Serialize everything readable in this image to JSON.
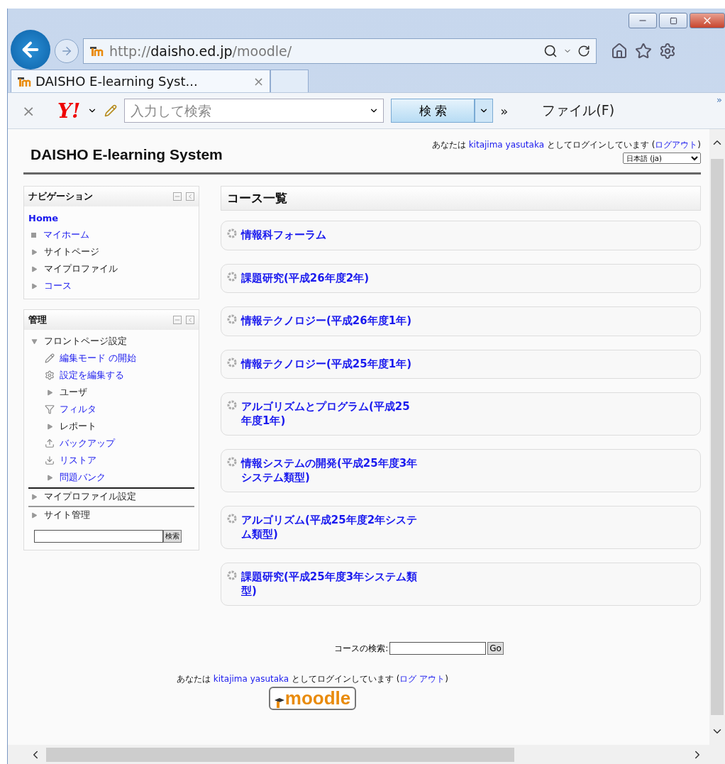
{
  "browser": {
    "address": {
      "scheme": "http://",
      "host": "daisho.ed.jp",
      "path": "/moodle/"
    },
    "tabs": [
      {
        "label": "DAISHO E-learning Syst...",
        "close": "×",
        "selected": true
      }
    ],
    "toolbar": {
      "close": "×",
      "brand": "Y!",
      "search_placeholder": "入力して検索",
      "search_button": "検 索",
      "more": "»",
      "menu": "ファイル(F)",
      "overflow": "»"
    }
  },
  "page": {
    "site_title": "DAISHO E-learning System",
    "login": {
      "before": "あなたは ",
      "user": "kitajima yasutaka",
      "after": " としてログインしています (",
      "logout": "ログアウト",
      "closing": ")"
    },
    "language": "日本語 (ja)",
    "navigation": {
      "title": "ナビゲーション",
      "items": [
        {
          "label": "Home",
          "kind": "home",
          "link": true,
          "children": [
            {
              "label": "マイホーム",
              "kind": "leaf",
              "link": true
            },
            {
              "label": "サイトページ",
              "kind": "branch",
              "expanded": false,
              "link": false
            },
            {
              "label": "マイプロファイル",
              "kind": "branch",
              "expanded": false,
              "link": false
            },
            {
              "label": "コース",
              "kind": "branch",
              "expanded": false,
              "link": true
            }
          ]
        }
      ]
    },
    "administration": {
      "title": "管理",
      "search_button": "検索",
      "items": [
        {
          "label": "フロントページ設定",
          "kind": "branch",
          "expanded": true,
          "link": false,
          "children": [
            {
              "label": "編集モード の開始",
              "kind": "pencil",
              "link": true
            },
            {
              "label": "設定を編集する",
              "kind": "gear",
              "link": true
            },
            {
              "label": "ユーザ",
              "kind": "branch",
              "expanded": false,
              "link": false
            },
            {
              "label": "フィルタ",
              "kind": "filter",
              "link": true
            },
            {
              "label": "レポート",
              "kind": "branch",
              "expanded": false,
              "link": false
            },
            {
              "label": "バックアップ",
              "kind": "backup",
              "link": true
            },
            {
              "label": "リストア",
              "kind": "restore",
              "link": true
            },
            {
              "label": "問題バンク",
              "kind": "branch",
              "expanded": false,
              "link": true
            }
          ]
        },
        {
          "label": "マイプロファイル設定",
          "kind": "branch",
          "expanded": false,
          "link": false
        },
        {
          "label": "サイト管理",
          "kind": "branch",
          "expanded": false,
          "link": false
        }
      ]
    },
    "courses": {
      "title": "コース一覧",
      "items": [
        "情報科フォーラム",
        "課題研究(平成26年度2年)",
        "情報テクノロジー(平成26年度1年)",
        "情報テクノロジー(平成25年度1年)",
        "アルゴリズムとプログラム(平成25年度1年)",
        "情報システムの開発(平成25年度3年システム類型)",
        "アルゴリズム(平成25年度2年システム類型)",
        "課題研究(平成25年度3年システム類型)"
      ]
    },
    "course_search": {
      "label": "コースの検索:",
      "button": "Go"
    },
    "footer_login": {
      "before": "あなたは ",
      "user": "kitajima yasutaka",
      "after": " としてログインしています (",
      "logout": "ログ アウト",
      "closing": ")"
    },
    "logo": "moodle"
  }
}
